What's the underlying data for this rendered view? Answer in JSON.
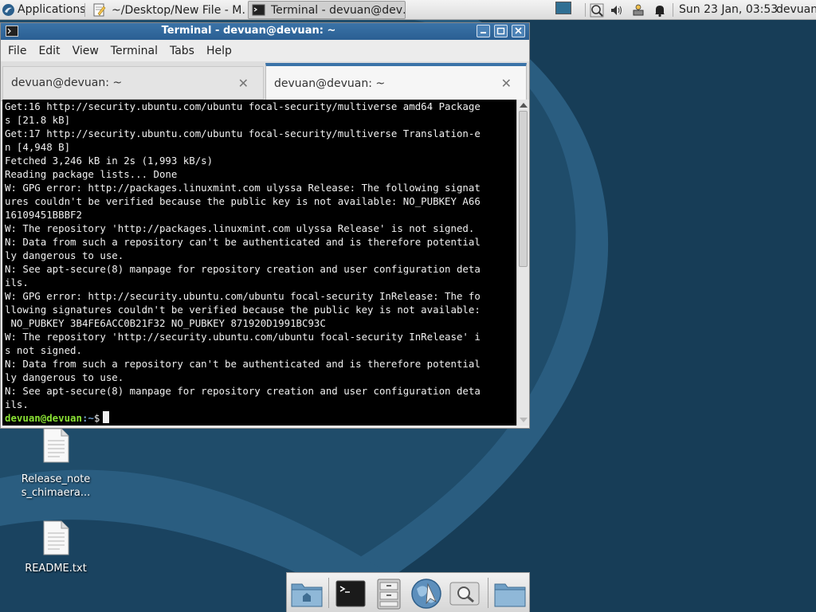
{
  "top_panel": {
    "applications_label": "Applications",
    "tasks": [
      {
        "label": "~/Desktop/New File - M…",
        "icon": "text-editor-icon"
      },
      {
        "label": "Terminal - devuan@dev…",
        "icon": "terminal-icon"
      }
    ],
    "clock": "Sun 23 Jan, 03:53",
    "username": "devuan",
    "tray_icons": [
      "screenshot-icon",
      "volume-icon",
      "network-icon",
      "notification-bell-icon"
    ]
  },
  "terminal": {
    "title": "Terminal - devuan@devuan: ~",
    "menu": [
      "File",
      "Edit",
      "View",
      "Terminal",
      "Tabs",
      "Help"
    ],
    "tabs": [
      {
        "label": "devuan@devuan: ~",
        "active": false
      },
      {
        "label": "devuan@devuan: ~",
        "active": true
      }
    ],
    "output_lines": [
      "Get:16 http://security.ubuntu.com/ubuntu focal-security/multiverse amd64 Package",
      "s [21.8 kB]",
      "Get:17 http://security.ubuntu.com/ubuntu focal-security/multiverse Translation-e",
      "n [4,948 B]",
      "Fetched 3,246 kB in 2s (1,993 kB/s)",
      "Reading package lists... Done",
      "W: GPG error: http://packages.linuxmint.com ulyssa Release: The following signat",
      "ures couldn't be verified because the public key is not available: NO_PUBKEY A66",
      "16109451BBBF2",
      "W: The repository 'http://packages.linuxmint.com ulyssa Release' is not signed.",
      "N: Data from such a repository can't be authenticated and is therefore potential",
      "ly dangerous to use.",
      "N: See apt-secure(8) manpage for repository creation and user configuration deta",
      "ils.",
      "W: GPG error: http://security.ubuntu.com/ubuntu focal-security InRelease: The fo",
      "llowing signatures couldn't be verified because the public key is not available:",
      " NO_PUBKEY 3B4FE6ACC0B21F32 NO_PUBKEY 871920D1991BC93C",
      "W: The repository 'http://security.ubuntu.com/ubuntu focal-security InRelease' i",
      "s not signed.",
      "N: Data from such a repository can't be authenticated and is therefore potential",
      "ly dangerous to use.",
      "N: See apt-secure(8) manpage for repository creation and user configuration deta",
      "ils."
    ],
    "prompt_user": "devuan@devuan",
    "prompt_path": ":~",
    "prompt_symbol": "$"
  },
  "desktop_icons": [
    {
      "label": "Release_note s_chimaera..."
    },
    {
      "label": "README.txt"
    }
  ],
  "dock": {
    "items": [
      "home-folder-icon",
      "terminal-icon",
      "file-cabinet-icon",
      "web-browser-icon",
      "search-icon",
      "folder-icon"
    ]
  },
  "colors": {
    "titlebar": "#2a5f93",
    "desktop": "#1f4c6a",
    "prompt_user": "#8ae234",
    "prompt_path": "#729fcf"
  }
}
